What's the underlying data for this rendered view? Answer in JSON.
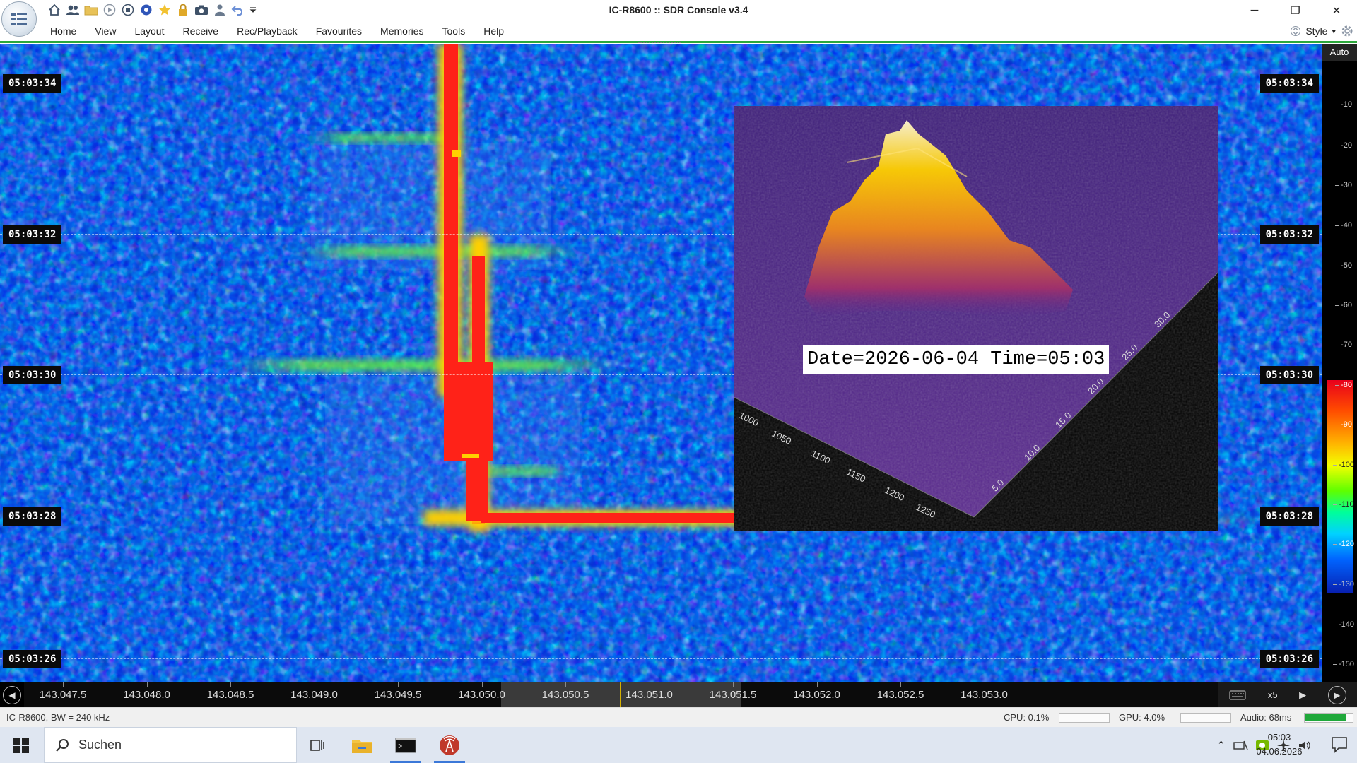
{
  "window": {
    "title": "IC-R8600 :: SDR Console v3.4",
    "minimize": "─",
    "restore": "❐",
    "close": "✕"
  },
  "quick_access": [
    "home-icon",
    "users-icon",
    "folder-icon",
    "play-icon",
    "stop-icon",
    "globe-icon",
    "star-icon",
    "lock-icon",
    "camera-icon",
    "person-icon",
    "undo-icon",
    "dropdown-icon"
  ],
  "menu": {
    "items": [
      "Home",
      "View",
      "Layout",
      "Receive",
      "Rec/Playback",
      "Favourites",
      "Memories",
      "Tools",
      "Help"
    ],
    "style_label": "Style",
    "style_arrow": "▾"
  },
  "waterfall": {
    "time_labels": [
      "05:03:34",
      "05:03:32",
      "05:03:30",
      "05:03:28",
      "05:03:26"
    ]
  },
  "inset_3d": {
    "date_text": "Date=2026-06-04 Time=05:03",
    "left_axis_ticks": [
      "1000",
      "1050",
      "1100",
      "1150",
      "1200",
      "1250"
    ],
    "right_axis_ticks": [
      "5.0",
      "10.0",
      "15.0",
      "20.0",
      "25.0",
      "30.0"
    ]
  },
  "level_scale": {
    "auto_label": "Auto",
    "ticks": [
      "-10",
      "-20",
      "-30",
      "-40",
      "-50",
      "-60",
      "-70",
      "-80",
      "-90",
      "-100",
      "-110",
      "-120",
      "-130",
      "-140",
      "-150"
    ]
  },
  "frequency_axis": {
    "labels": [
      "143.047.5",
      "143.048.0",
      "143.048.5",
      "143.049.0",
      "143.049.5",
      "143.050.0",
      "143.050.5",
      "143.051.0",
      "143.051.5",
      "143.052.0",
      "143.052.5",
      "143.053.0"
    ],
    "zoom_label": "x5"
  },
  "status_bar": {
    "left_text": "IC-R8600, BW = 240 kHz",
    "cpu": "CPU: 0.1%",
    "gpu": "GPU: 4.0%",
    "audio": "Audio: 68ms",
    "audio_level": 0.85
  },
  "taskbar": {
    "search_text": "Suchen",
    "time": "05:03",
    "date": "04.06.2026"
  },
  "colors": {
    "accent": "#2ca83c",
    "waterfall_base": "#0a2fd6",
    "signal_hot": "#ff1a1a",
    "signal_warm": "#ffd000",
    "taskbar": "#dfe6f1"
  }
}
